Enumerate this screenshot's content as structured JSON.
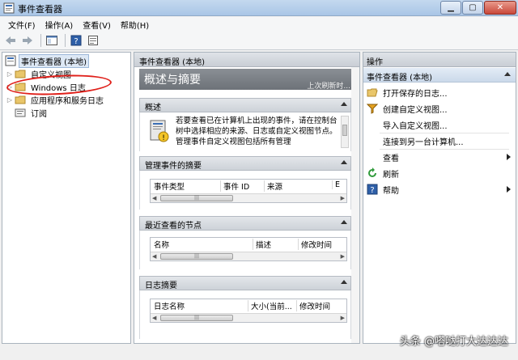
{
  "window": {
    "title": "事件查看器"
  },
  "menu": [
    "文件(F)",
    "操作(A)",
    "查看(V)",
    "帮助(H)"
  ],
  "tree": {
    "root": "事件查看器 (本地)",
    "items": [
      "自定义视图",
      "Windows 日志",
      "应用程序和服务日志",
      "订阅"
    ]
  },
  "center": {
    "header": "事件查看器 (本地)",
    "banner_title": "概述与摘要",
    "banner_time": "上次刷新时...",
    "overview": {
      "title": "概述",
      "text": "若要查看已在计算机上出现的事件，请在控制台树中选择相应的来源、日志或自定义视图节点。管理事件自定义视图包括所有管理"
    },
    "admin_summary": {
      "title": "管理事件的摘要",
      "columns": [
        "事件类型",
        "事件 ID",
        "来源",
        "E"
      ]
    },
    "recent_nodes": {
      "title": "最近查看的节点",
      "columns": [
        "名称",
        "描述",
        "修改时间"
      ]
    },
    "log_summary": {
      "title": "日志摘要",
      "columns": [
        "日志名称",
        "大小(当前...",
        "修改时间"
      ]
    }
  },
  "actions": {
    "header": "操作",
    "section": "事件查看器 (本地)",
    "items": [
      "打开保存的日志...",
      "创建自定义视图...",
      "导入自定义视图...",
      "连接到另一台计算机...",
      "查看",
      "刷新",
      "帮助"
    ]
  },
  "watermark": "头条 @嗒哒打大达达达",
  "icons": {
    "app": "event-viewer-icon",
    "back": "back-arrow-icon",
    "forward": "forward-arrow-icon"
  }
}
